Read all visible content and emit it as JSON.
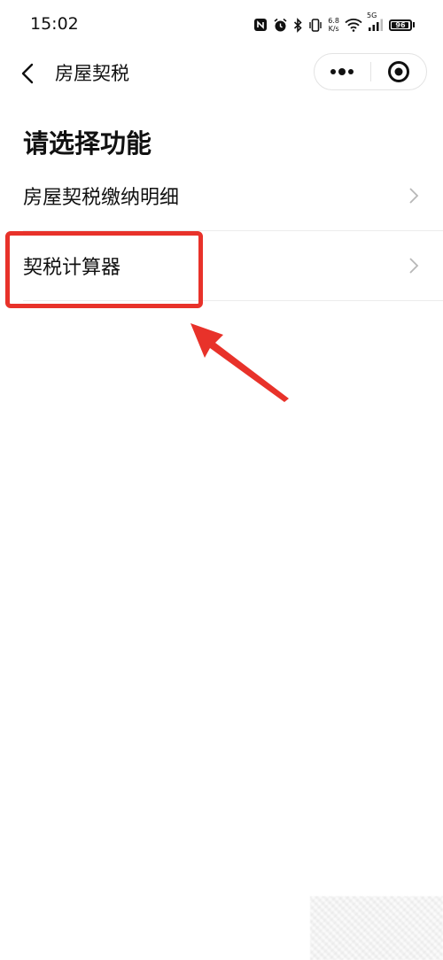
{
  "status_bar": {
    "time": "15:02",
    "net_speed_value": "6.8",
    "net_speed_unit": "K/s",
    "signal_label": "5G",
    "battery": "96",
    "battery_level": 0.96,
    "icons": [
      "nfc-icon",
      "alarm-icon",
      "bluetooth-icon",
      "vibrate-icon",
      "wifi-icon",
      "signal-icon",
      "battery-icon"
    ]
  },
  "nav": {
    "title": "房屋契税",
    "back_icon": "chevron-left-icon",
    "more_icon": "more-dots-icon",
    "close_icon": "target-circle-icon"
  },
  "main": {
    "title": "请选择功能",
    "items": [
      {
        "label": "房屋契税缴纳明细",
        "icon": "chevron-right-icon"
      },
      {
        "label": "契税计算器",
        "icon": "chevron-right-icon"
      }
    ]
  },
  "annotation": {
    "highlight_color": "#e8322a",
    "arrow_color": "#e8322a"
  }
}
